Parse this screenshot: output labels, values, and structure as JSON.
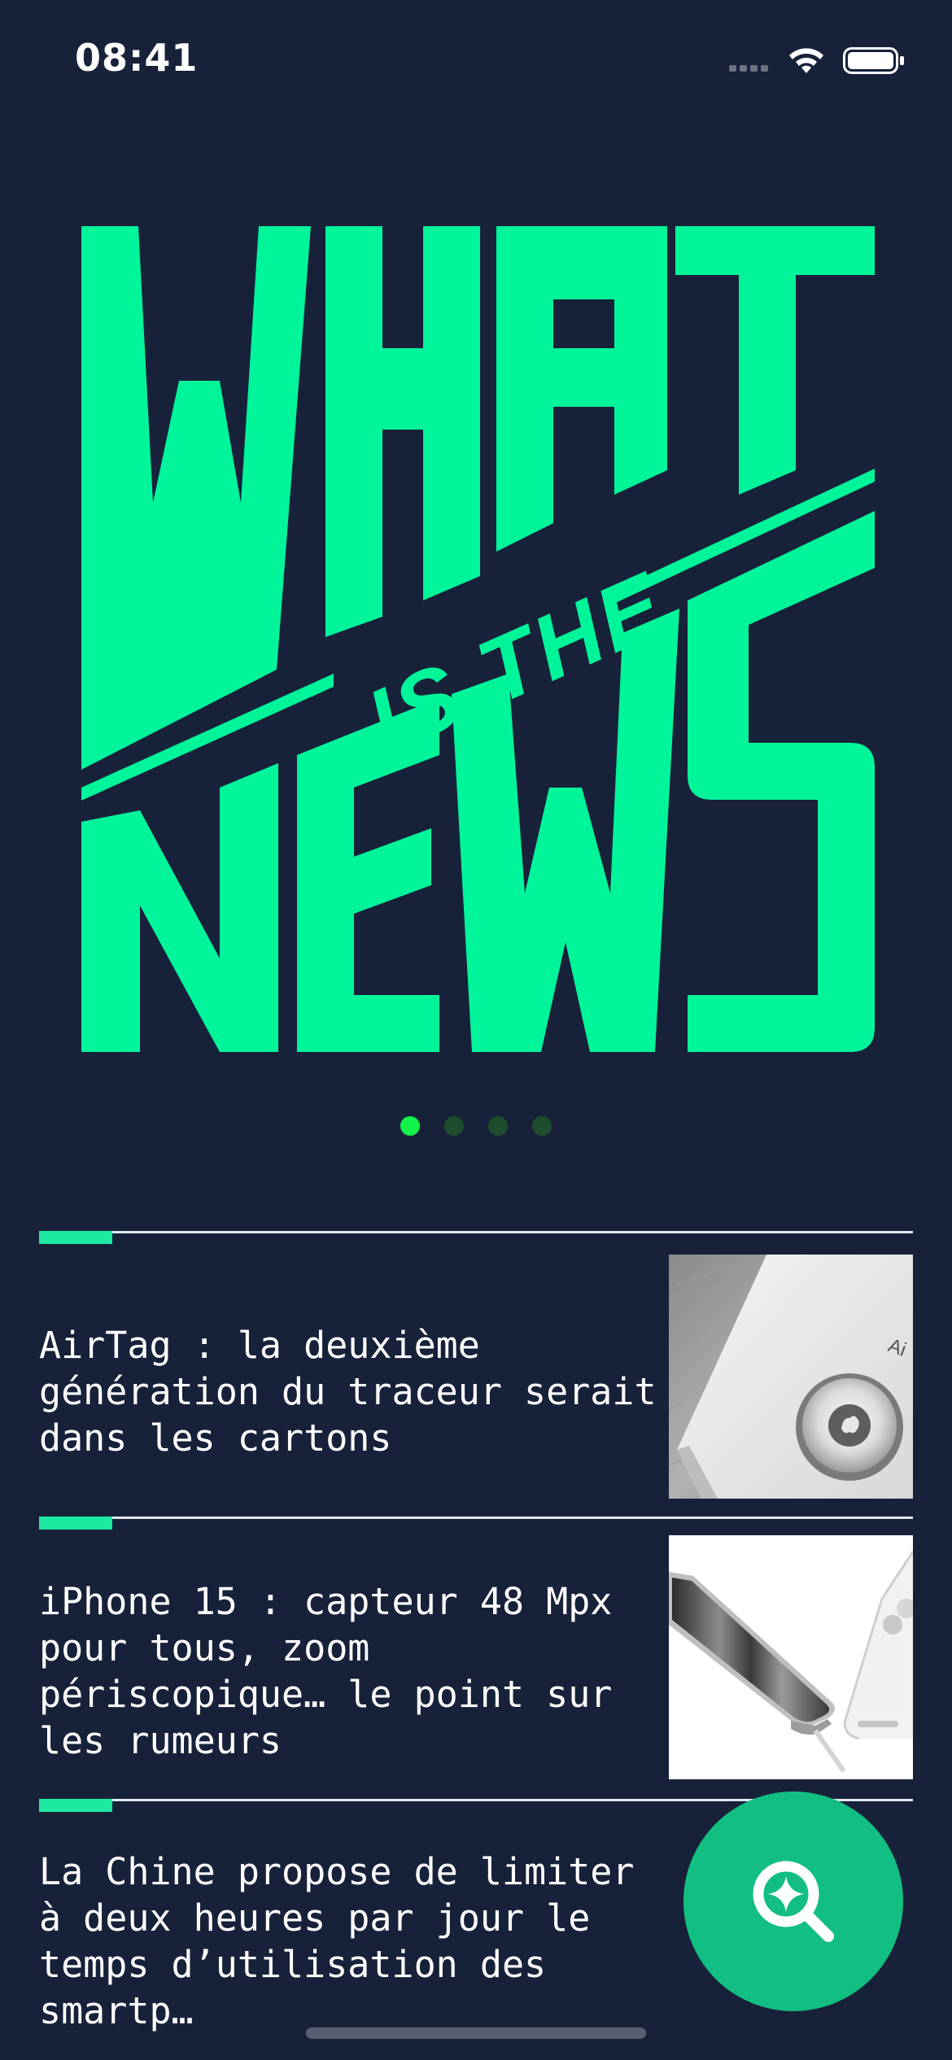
{
  "status_bar": {
    "time": "08:41"
  },
  "hero": {
    "line1": "WHAT",
    "line2": "IS THE",
    "line3": "NEWS",
    "color": "#00f59b"
  },
  "pager": {
    "count": 4,
    "active_index": 0
  },
  "articles": [
    {
      "title": "AirTag : la deuxième génération du traceur serait dans les cartons",
      "image": "airtag-photo"
    },
    {
      "title": "iPhone 15 : capteur 48 Mpx pour tous, zoom périscopique… le point sur les rumeurs",
      "image": "iphone-photo"
    },
    {
      "title": "La Chine propose de limiter à deux heures par jour le temps d’utilisation des smartp…",
      "image": ""
    }
  ],
  "fab": {
    "icon": "search-sparkle-icon"
  },
  "colors": {
    "background": "#17223a",
    "accent": "#1de9a0",
    "fab": "#13be82",
    "active_dot": "#12f24a"
  }
}
